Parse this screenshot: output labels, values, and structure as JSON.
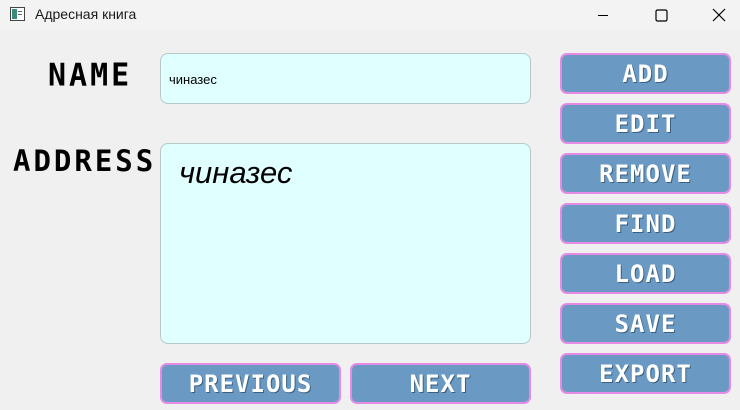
{
  "window": {
    "title": "Адресная книга",
    "icons": {
      "app": "address-book-icon",
      "minimize": "minimize-icon",
      "maximize": "maximize-icon",
      "close": "close-icon"
    }
  },
  "form": {
    "name_label": "NAME",
    "address_label": "ADDRESS",
    "name_value": "чиназес",
    "address_value": "чиназес"
  },
  "buttons": {
    "add": "ADD",
    "edit": "EDIT",
    "remove": "REMOVE",
    "find": "FIND",
    "load": "LOAD",
    "save": "SAVE",
    "export": "EXPORT",
    "previous": "PREVIOUS",
    "next": "NEXT"
  },
  "colors": {
    "button_fill": "#6a9ac4",
    "button_border": "#e58be5",
    "field_background": "#e0ffff"
  }
}
